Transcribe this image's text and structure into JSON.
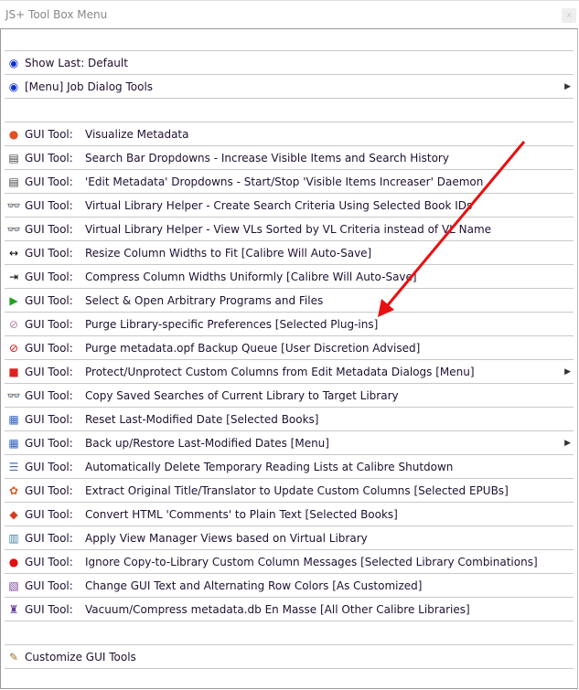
{
  "window": {
    "title": "JS+ Tool Box Menu",
    "close": "x"
  },
  "items": [
    {
      "type": "blank"
    },
    {
      "icon": "eye-icon",
      "glyph": "◉",
      "color": "#1030d0",
      "label": "Show Last: Default"
    },
    {
      "icon": "eye-icon",
      "glyph": "◉",
      "color": "#1030d0",
      "label": "[Menu] Job Dialog Tools",
      "submenu": true
    },
    {
      "type": "blank"
    },
    {
      "icon": "pie-chart-icon",
      "glyph": "●",
      "color": "#e05020",
      "prefix": "GUI Tool:",
      "label": "Visualize Metadata"
    },
    {
      "icon": "dropdown-list-icon",
      "glyph": "▤",
      "color": "#444",
      "prefix": "GUI Tool:",
      "label": "Search Bar Dropdowns - Increase Visible Items and Search History"
    },
    {
      "icon": "dropdown-list-icon",
      "glyph": "▤",
      "color": "#444",
      "prefix": "GUI Tool:",
      "label": "'Edit Metadata' Dropdowns - Start/Stop 'Visible Items Increaser' Daemon"
    },
    {
      "icon": "binoculars-icon",
      "glyph": "👓",
      "color": "#553",
      "prefix": "GUI Tool:",
      "label": "Virtual Library Helper - Create Search Criteria Using Selected Book IDs"
    },
    {
      "icon": "binoculars-icon",
      "glyph": "👓",
      "color": "#553",
      "prefix": "GUI Tool:",
      "label": "Virtual Library Helper - View VLs Sorted by VL Criteria instead of VL Name"
    },
    {
      "icon": "resize-arrows-icon",
      "glyph": "↔",
      "color": "#000",
      "prefix": "GUI Tool:",
      "label": "Resize Column Widths to Fit [Calibre Will Auto-Save]"
    },
    {
      "icon": "compress-arrows-icon",
      "glyph": "⇥",
      "color": "#000",
      "prefix": "GUI Tool:",
      "label": "Compress Column Widths Uniformly [Calibre Will Auto-Save]"
    },
    {
      "icon": "play-icon",
      "glyph": "▶",
      "color": "#20a020",
      "prefix": "GUI Tool:",
      "label": "Select & Open Arbitrary Programs and Files"
    },
    {
      "icon": "eraser-icon",
      "glyph": "⊘",
      "color": "#b080a0",
      "prefix": "GUI Tool:",
      "label": "Purge Library-specific Preferences [Selected Plug-ins]"
    },
    {
      "icon": "prohibited-icon",
      "glyph": "⊘",
      "color": "#d01010",
      "prefix": "GUI Tool:",
      "label": "Purge metadata.opf Backup Queue [User Discretion Advised]"
    },
    {
      "icon": "lock-icon",
      "glyph": "■",
      "color": "#e02020",
      "prefix": "GUI Tool:",
      "label": "Protect/Unprotect Custom Columns from Edit Metadata Dialogs [Menu]",
      "submenu": true
    },
    {
      "icon": "binoculars-icon",
      "glyph": "👓",
      "color": "#553",
      "prefix": "GUI Tool:",
      "label": "Copy Saved Searches of Current Library to Target Library"
    },
    {
      "icon": "calendar-icon",
      "glyph": "▦",
      "color": "#3060c0",
      "prefix": "GUI Tool:",
      "label": "Reset Last-Modified Date [Selected Books]"
    },
    {
      "icon": "calendar-icon",
      "glyph": "▦",
      "color": "#3060c0",
      "prefix": "GUI Tool:",
      "label": "Back up/Restore Last-Modified Dates [Menu]",
      "submenu": true
    },
    {
      "icon": "reading-list-icon",
      "glyph": "☰",
      "color": "#5070b0",
      "prefix": "GUI Tool:",
      "label": "Automatically Delete Temporary Reading Lists at Calibre Shutdown"
    },
    {
      "icon": "translate-icon",
      "glyph": "✿",
      "color": "#d06030",
      "prefix": "GUI Tool:",
      "label": "Extract Original Title/Translator to Update Custom Columns [Selected EPUBs]"
    },
    {
      "icon": "html-icon",
      "glyph": "◆",
      "color": "#d04020",
      "prefix": "GUI Tool:",
      "label": "Convert HTML 'Comments' to Plain Text [Selected Books]"
    },
    {
      "icon": "view-manager-icon",
      "glyph": "▥",
      "color": "#4080a0",
      "prefix": "GUI Tool:",
      "label": "Apply View Manager Views based on Virtual Library"
    },
    {
      "icon": "red-ball-icon",
      "glyph": "●",
      "color": "#e01010",
      "prefix": "GUI Tool:",
      "label": "Ignore Copy-to-Library Custom Column Messages [Selected Library Combinations]"
    },
    {
      "icon": "palette-icon",
      "glyph": "▧",
      "color": "#8040a0",
      "prefix": "GUI Tool:",
      "label": "Change GUI Text and Alternating Row Colors [As Customized]"
    },
    {
      "icon": "vacuum-icon",
      "glyph": "♜",
      "color": "#6040a0",
      "prefix": "GUI Tool:",
      "label": "Vacuum/Compress metadata.db En Masse [All Other Calibre Libraries]"
    },
    {
      "type": "blank"
    },
    {
      "icon": "wand-icon",
      "glyph": "✎",
      "color": "#a07020",
      "label": "Customize GUI Tools"
    }
  ],
  "annotation_color": "#e81010"
}
